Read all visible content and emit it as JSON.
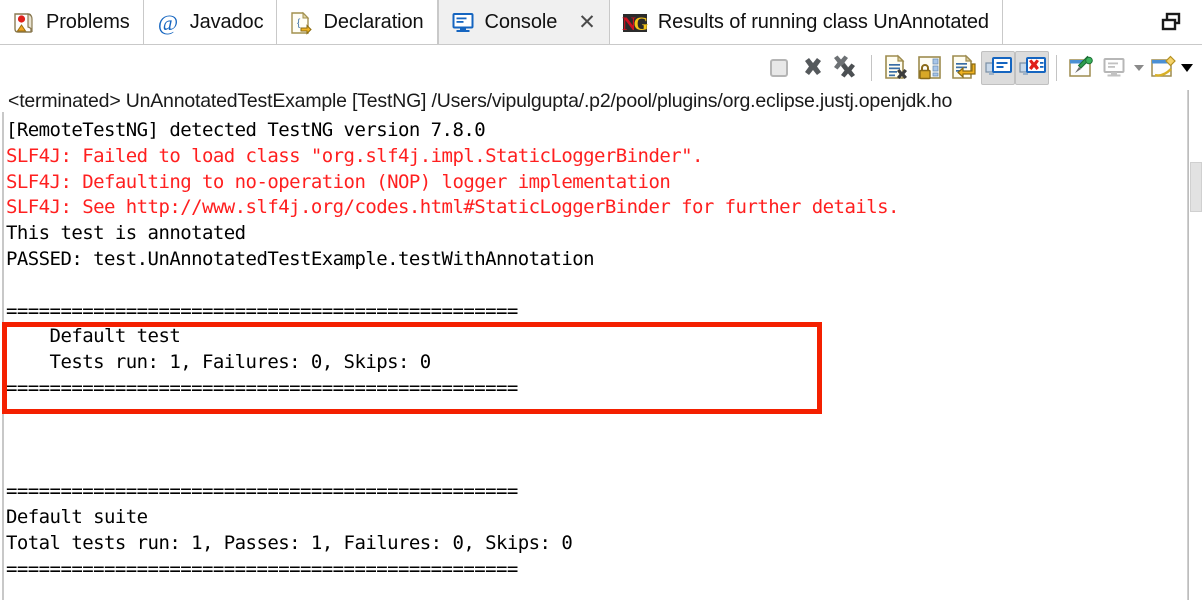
{
  "window": {
    "restore_icon": "restore-window-icon"
  },
  "tabs": [
    {
      "id": "problems",
      "label": "Problems",
      "icon": "problems-icon",
      "active": false,
      "closable": false
    },
    {
      "id": "javadoc",
      "label": "Javadoc",
      "icon": "at-sign-icon",
      "active": false,
      "closable": false
    },
    {
      "id": "declaration",
      "label": "Declaration",
      "icon": "declaration-icon",
      "active": false,
      "closable": false
    },
    {
      "id": "console",
      "label": "Console",
      "icon": "console-icon",
      "active": true,
      "closable": true,
      "close_label": "✕"
    },
    {
      "id": "testng",
      "label": "Results of running class UnAnnotated",
      "icon": "testng-icon",
      "active": false,
      "closable": false
    }
  ],
  "toolbar": {
    "buttons": [
      {
        "id": "terminate",
        "icon": "terminate-square-icon",
        "title": "Terminate",
        "pressed": false,
        "enabled": false
      },
      {
        "id": "remove",
        "icon": "remove-x-icon",
        "title": "Remove Launch",
        "pressed": false,
        "enabled": true
      },
      {
        "id": "remove-all",
        "icon": "remove-all-xx-icon",
        "title": "Remove All Terminated Launches",
        "pressed": false,
        "enabled": true
      },
      {
        "id": "clear-console",
        "icon": "clear-console-icon",
        "title": "Clear Console",
        "pressed": false,
        "enabled": true
      },
      {
        "id": "scroll-lock",
        "icon": "scroll-lock-icon",
        "title": "Scroll Lock",
        "pressed": false,
        "enabled": true
      },
      {
        "id": "word-wrap",
        "icon": "word-wrap-icon",
        "title": "Word Wrap",
        "pressed": false,
        "enabled": true
      },
      {
        "id": "show-console-output",
        "icon": "show-console-on-output-icon",
        "title": "Show Console When Standard Out Changes",
        "pressed": true,
        "enabled": true
      },
      {
        "id": "show-console-error",
        "icon": "show-console-on-error-icon",
        "title": "Show Console When Standard Error Changes",
        "pressed": true,
        "enabled": true
      },
      {
        "id": "pin-console",
        "icon": "pin-console-icon",
        "title": "Pin Console",
        "pressed": false,
        "enabled": true
      },
      {
        "id": "display-console",
        "icon": "display-selected-console-icon",
        "title": "Display Selected Console",
        "pressed": false,
        "enabled": false
      },
      {
        "id": "open-console",
        "icon": "open-console-icon",
        "title": "Open Console",
        "pressed": false,
        "enabled": true
      }
    ],
    "dropdown_gray": "chevron-down-icon",
    "dropdown_black": "chevron-down-icon"
  },
  "console": {
    "terminated_line": "<terminated> UnAnnotatedTestExample [TestNG] /Users/vipulgupta/.p2/pool/plugins/org.eclipse.justj.openjdk.ho",
    "lines": [
      {
        "text": "[RemoteTestNG] detected TestNG version 7.8.0",
        "color": "black"
      },
      {
        "text": "SLF4J: Failed to load class \"org.slf4j.impl.StaticLoggerBinder\".",
        "color": "red"
      },
      {
        "text": "SLF4J: Defaulting to no-operation (NOP) logger implementation",
        "color": "red"
      },
      {
        "text": "SLF4J: See http://www.slf4j.org/codes.html#StaticLoggerBinder for further details.",
        "color": "red"
      },
      {
        "text": "This test is annotated",
        "color": "black"
      },
      {
        "text": "PASSED: test.UnAnnotatedTestExample.testWithAnnotation",
        "color": "black"
      },
      {
        "text": "",
        "color": "black"
      },
      {
        "text": "===============================================",
        "color": "black"
      },
      {
        "text": "    Default test",
        "color": "black"
      },
      {
        "text": "    Tests run: 1, Failures: 0, Skips: 0",
        "color": "black"
      },
      {
        "text": "===============================================",
        "color": "black"
      },
      {
        "text": "",
        "color": "black"
      },
      {
        "text": "",
        "color": "black"
      },
      {
        "text": "",
        "color": "black"
      },
      {
        "text": "===============================================",
        "color": "black"
      },
      {
        "text": "Default suite",
        "color": "black"
      },
      {
        "text": "Total tests run: 1, Passes: 1, Failures: 0, Skips: 0",
        "color": "black"
      },
      {
        "text": "===============================================",
        "color": "black"
      }
    ],
    "annotation_highlight": {
      "name": "red-highlight-rectangle",
      "color": "#f42000",
      "covers_lines": [
        "This test is annotated",
        "PASSED: test.UnAnnotatedTestExample.testWithAnnotation"
      ]
    }
  },
  "colors": {
    "error_text": "#ff1f1f",
    "normal_text": "#000000",
    "highlight_border": "#f42000",
    "active_tab_bg": "#f0f0f0",
    "window_bg": "#ffffff"
  },
  "scrollbar": {
    "name": "vertical-scrollbar",
    "thumb": "scrollbar-thumb"
  }
}
